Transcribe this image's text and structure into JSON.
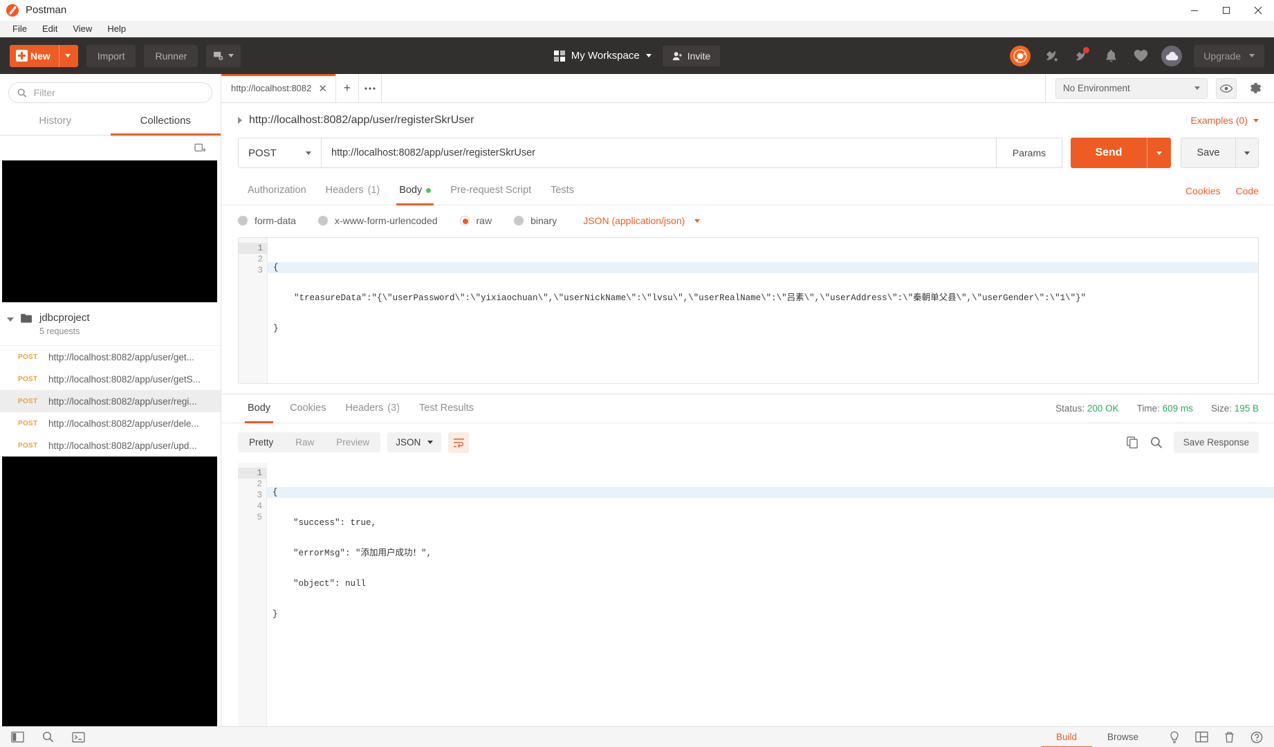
{
  "window": {
    "app_title": "Postman",
    "minimize": "–",
    "maximize": "□",
    "close": "✕"
  },
  "menu": {
    "items": [
      {
        "label": "File"
      },
      {
        "label": "Edit"
      },
      {
        "label": "View"
      },
      {
        "label": "Help"
      }
    ]
  },
  "toolbar": {
    "new_label": "New",
    "import_label": "Import",
    "runner_label": "Runner",
    "workspace_label": "My Workspace",
    "invite_label": "Invite",
    "upgrade_label": "Upgrade",
    "icons": {
      "interceptor": "interceptor-icon",
      "satellite": "satellite-icon",
      "sync": "sync-icon",
      "bell": "bell-icon",
      "heart": "heart-icon",
      "cloud_avatar": "cloud-avatar-icon"
    }
  },
  "sidebar": {
    "filter_placeholder": "Filter",
    "filter_value": "",
    "tabs": [
      {
        "label": "History",
        "active": false
      },
      {
        "label": "Collections",
        "active": true
      }
    ],
    "collection": {
      "name": "jdbcproject",
      "count_label": "5 requests"
    },
    "requests": [
      {
        "method": "POST",
        "url": "http://localhost:8082/app/user/get...",
        "selected": false
      },
      {
        "method": "POST",
        "url": "http://localhost:8082/app/user/getS...",
        "selected": false
      },
      {
        "method": "POST",
        "url": "http://localhost:8082/app/user/regi...",
        "selected": true
      },
      {
        "method": "POST",
        "url": "http://localhost:8082/app/user/dele...",
        "selected": false
      },
      {
        "method": "POST",
        "url": "http://localhost:8082/app/user/upd...",
        "selected": false
      }
    ]
  },
  "request_tabs": {
    "open_tab_label": "http://localhost:8082",
    "add_label": "+",
    "more_label": "•••"
  },
  "environment": {
    "selected": "No Environment"
  },
  "request": {
    "title": "http://localhost:8082/app/user/registerSkrUser",
    "examples_label": "Examples (0)",
    "method": "POST",
    "url": "http://localhost:8082/app/user/registerSkrUser",
    "params_label": "Params",
    "send_label": "Send",
    "save_label": "Save",
    "tabs": [
      {
        "label": "Authorization",
        "active": false,
        "count": ""
      },
      {
        "label": "Headers",
        "active": false,
        "count": "(1)"
      },
      {
        "label": "Body",
        "active": true,
        "count": ""
      },
      {
        "label": "Pre-request Script",
        "active": false,
        "count": ""
      },
      {
        "label": "Tests",
        "active": false,
        "count": ""
      }
    ],
    "cookies_link": "Cookies",
    "code_link": "Code",
    "body_types": [
      {
        "label": "form-data",
        "selected": false
      },
      {
        "label": "x-www-form-urlencoded",
        "selected": false
      },
      {
        "label": "raw",
        "selected": true
      },
      {
        "label": "binary",
        "selected": false
      }
    ],
    "body_format": "JSON (application/json)",
    "body_lines": [
      {
        "n": "1",
        "text": "{",
        "fold": true,
        "highlight": true
      },
      {
        "n": "2",
        "text": "    \"treasureData\":\"{\\\"userPassword\\\":\\\"yixiaochuan\\\",\\\"userNickName\\\":\\\"lvsu\\\",\\\"userRealName\\\":\\\"吕素\\\",\\\"userAddress\\\":\\\"秦朝单父县\\\",\\\"userGender\\\":\\\"1\\\"}\"",
        "fold": false,
        "highlight": false
      },
      {
        "n": "3",
        "text": "}",
        "fold": false,
        "highlight": false
      }
    ]
  },
  "response": {
    "tabs": [
      {
        "label": "Body",
        "active": true,
        "count": ""
      },
      {
        "label": "Cookies",
        "active": false,
        "count": ""
      },
      {
        "label": "Headers",
        "active": false,
        "count": "(3)"
      },
      {
        "label": "Test Results",
        "active": false,
        "count": ""
      }
    ],
    "status_label": "Status:",
    "status_value": "200 OK",
    "time_label": "Time:",
    "time_value": "609 ms",
    "size_label": "Size:",
    "size_value": "195 B",
    "view_modes": [
      {
        "label": "Pretty",
        "active": true
      },
      {
        "label": "Raw",
        "active": false
      },
      {
        "label": "Preview",
        "active": false
      }
    ],
    "format": "JSON",
    "save_response_label": "Save Response",
    "body_lines": [
      {
        "n": "1",
        "text": "{",
        "fold": true,
        "highlight": true
      },
      {
        "n": "2",
        "text": "    \"success\": true,",
        "fold": false,
        "highlight": false
      },
      {
        "n": "3",
        "text": "    \"errorMsg\": \"添加用户成功！\",",
        "fold": false,
        "highlight": false
      },
      {
        "n": "4",
        "text": "    \"object\": null",
        "fold": false,
        "highlight": false
      },
      {
        "n": "5",
        "text": "}",
        "fold": false,
        "highlight": false
      }
    ]
  },
  "statusbar": {
    "build_label": "Build",
    "browse_label": "Browse"
  },
  "colors": {
    "accent": "#ef5b25",
    "toolbar_bg": "#32302f",
    "status_green": "#2eaa5e",
    "method_orange": "#e8a33d"
  }
}
